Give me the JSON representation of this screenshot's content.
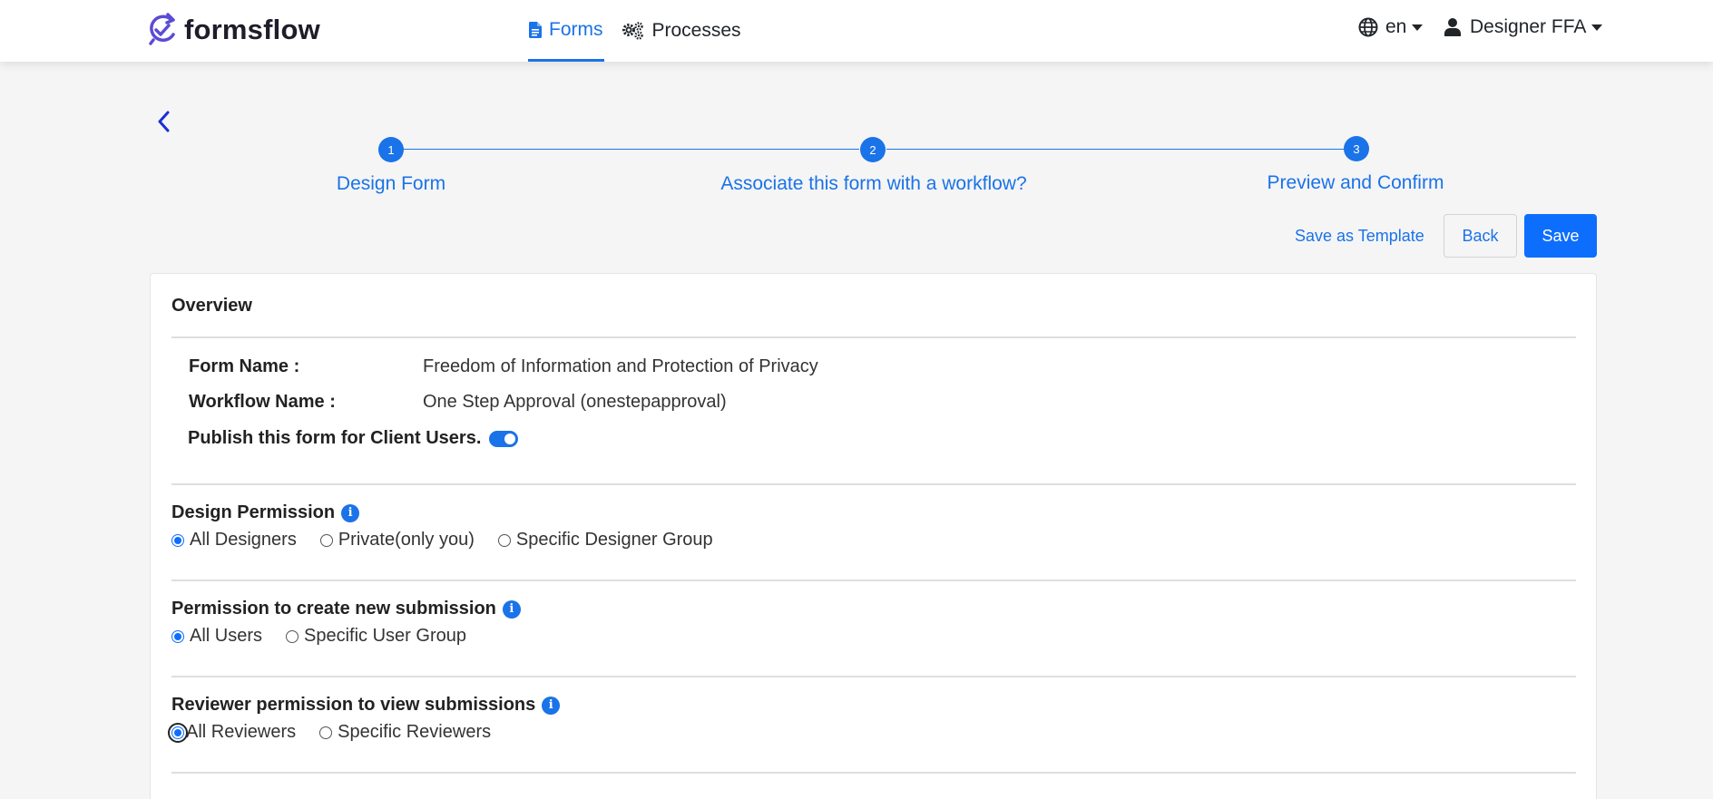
{
  "header": {
    "logo_text": "formsflow",
    "nav": {
      "forms": "Forms",
      "processes": "Processes"
    },
    "language": "en",
    "user": "Designer FFA"
  },
  "stepper": {
    "steps": [
      {
        "number": "1",
        "label": "Design Form"
      },
      {
        "number": "2",
        "label": "Associate this form with a workflow?"
      },
      {
        "number": "3",
        "label": "Preview and Confirm"
      }
    ]
  },
  "actions": {
    "save_template": "Save as Template",
    "back": "Back",
    "save": "Save"
  },
  "overview": {
    "title": "Overview",
    "form_name_label": "Form Name :",
    "form_name_value": "Freedom of Information and Protection of Privacy",
    "workflow_name_label": "Workflow Name :",
    "workflow_name_value": "One Step Approval (onestepapproval)",
    "publish_label": "Publish this form for Client Users.",
    "publish_enabled": true
  },
  "design_permission": {
    "title": "Design Permission",
    "options": [
      "All Designers",
      "Private(only you)",
      "Specific Designer Group"
    ],
    "selected": "All Designers"
  },
  "submission_permission": {
    "title": "Permission to create new submission",
    "options": [
      "All Users",
      "Specific User Group"
    ],
    "selected": "All Users"
  },
  "reviewer_permission": {
    "title": "Reviewer permission to view submissions",
    "options": [
      "All Reviewers",
      "Specific Reviewers"
    ],
    "selected": "All Reviewers"
  },
  "colors": {
    "accent": "#1a73e8",
    "primary_button": "#0d6efd",
    "background": "#f5f5f5"
  }
}
